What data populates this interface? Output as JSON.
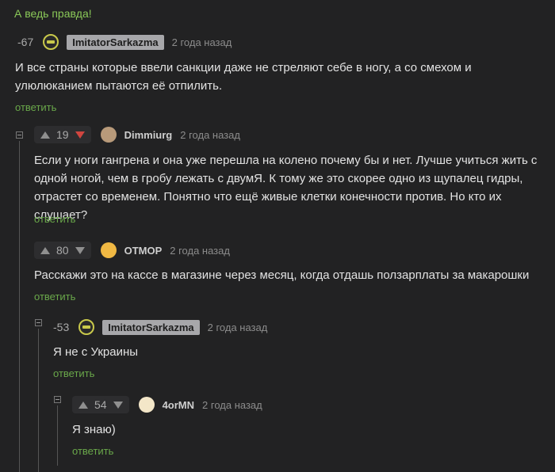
{
  "top_link": "А ведь правда!",
  "comments": [
    {
      "score": "-67",
      "author": "ImitatorSarkazma",
      "time": "2 года назад",
      "text": "И все страны которые ввели санкции даже не стреляют себе в ногу, а со смехом и улюлюканием пытаются её отпилить.",
      "reply": "ответить"
    },
    {
      "score": "19",
      "author": "Dimmiurg",
      "time": "2 года назад",
      "text": "Если у ноги гангрена и она уже перешла на колено почему бы и нет. Лучше учиться жить с одной ногой, чем в гробу лежать с двумЯ. К тому же это скорее одно из щупалец гидры, отрастет со временем. Понятно что ещё живые клетки конечности против. Но кто их слушает?",
      "reply": "ответить"
    },
    {
      "score": "80",
      "author": "ОТМОР",
      "time": "2 года назад",
      "text": "Расскажи это на кассе в магазине через месяц, когда отдашь ползарплаты за макарошки",
      "reply": "ответить"
    },
    {
      "score": "-53",
      "author": "ImitatorSarkazma",
      "time": "2 года назад",
      "text": "Я не с Украины",
      "reply": "ответить"
    },
    {
      "score": "54",
      "author": "4orMN",
      "time": "2 года назад",
      "text": "Я знаю)",
      "reply": "ответить"
    }
  ]
}
